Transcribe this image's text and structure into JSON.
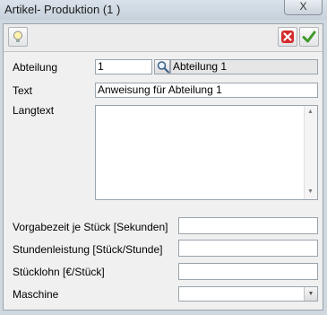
{
  "window": {
    "title": "Artikel- Produktion (1 )",
    "close_label": "X"
  },
  "toolbar": {
    "hint_icon": "lightbulb-icon",
    "cancel_icon": "red-x-icon",
    "confirm_icon": "green-check-icon"
  },
  "form": {
    "abteilung": {
      "label": "Abteilung",
      "value": "1",
      "description": "Abteilung 1"
    },
    "text": {
      "label": "Text",
      "value": "Anweisung für Abteilung 1"
    },
    "langtext": {
      "label": "Langtext",
      "value": ""
    },
    "vorgabezeit": {
      "label": "Vorgabezeit je Stück [Sekunden]",
      "value": ""
    },
    "stundenleistung": {
      "label": "Stundenleistung [Stück/Stunde]",
      "value": ""
    },
    "stuecklohn": {
      "label": "Stücklohn [€/Stück]",
      "value": ""
    },
    "maschine": {
      "label": "Maschine",
      "value": ""
    }
  },
  "colors": {
    "accent_cancel": "#d42b2b",
    "accent_ok": "#3f9a2b"
  }
}
